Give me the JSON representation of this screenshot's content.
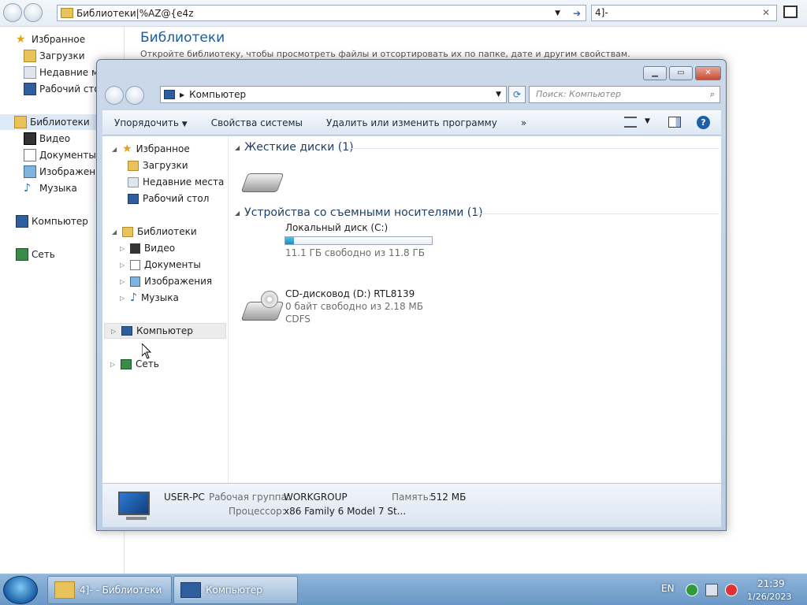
{
  "background": {
    "address": "Библиотеки|%AZ@{e4z",
    "search": "4]-",
    "title": "Библиотеки",
    "subtitle": "Откройте библиотеку, чтобы просмотреть файлы и отсортировать их по папке, дате и другим свойствам.",
    "sidebar": {
      "favorites": "Избранное",
      "downloads": "Загрузки",
      "recent": "Недавние ме",
      "desktop": "Рабочий стол",
      "libraries": "Библиотеки",
      "video": "Видео",
      "documents": "Документы",
      "images": "Изображени",
      "music": "Музыка",
      "computer": "Компьютер",
      "network": "Сеть"
    }
  },
  "window": {
    "address": "Компьютер",
    "search_placeholder": "Поиск: Компьютер",
    "toolbar": {
      "organize": "Упорядочить",
      "system_props": "Свойства системы",
      "uninstall": "Удалить или изменить программу",
      "more": "»"
    },
    "tree": {
      "favorites": "Избранное",
      "downloads": "Загрузки",
      "recent": "Недавние места",
      "desktop": "Рабочий стол",
      "libraries": "Библиотеки",
      "video": "Видео",
      "documents": "Документы",
      "images": "Изображения",
      "music": "Музыка",
      "computer": "Компьютер",
      "network": "Сеть"
    },
    "sections": {
      "hdd": "Жесткие диски (1)",
      "removable": "Устройства со съемными носителями (1)"
    },
    "drives": {
      "local_name": "Локальный диск (C:)",
      "local_free": "11.1 ГБ свободно из 11.8 ГБ",
      "local_used_fraction": 0.06,
      "cd_name": "CD-дисковод (D:) RTL8139",
      "cd_free": "0 байт свободно из 2.18 МБ",
      "cd_fs": "CDFS"
    },
    "status": {
      "pc_name": "USER-PC",
      "workgroup_label": "Рабочая группа:",
      "workgroup": "WORKGROUP",
      "memory_label": "Память:",
      "memory": "512 МБ",
      "cpu_label": "Процессор:",
      "cpu": "x86 Family 6 Model 7 St..."
    }
  },
  "taskbar": {
    "task1": "4]- - Библиотеки",
    "task2": "Компьютер",
    "lang": "EN",
    "time": "21:39",
    "date": "1/26/2023"
  }
}
